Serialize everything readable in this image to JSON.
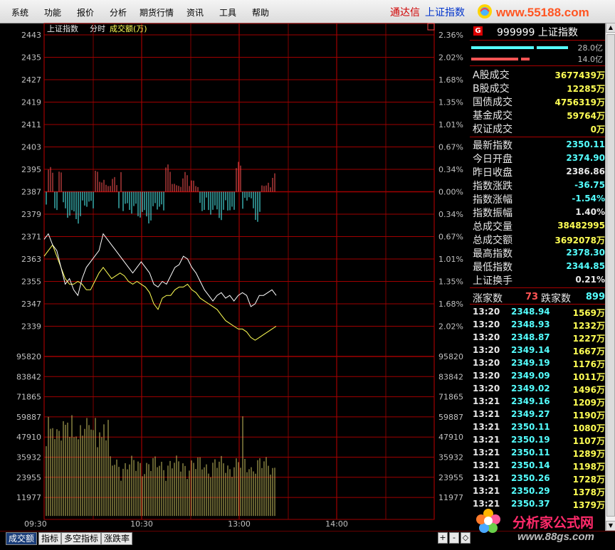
{
  "menu": [
    "系统",
    "功能",
    "报价",
    "分析",
    "期货行情",
    "资讯",
    "工具",
    "帮助"
  ],
  "app_name": "通达信",
  "current_index": "上证指数",
  "site_url": "www.55188.com",
  "chart": {
    "title": "上证指数",
    "mode": "分时",
    "volume_label": "成交额(万)",
    "price_ticks_left": [
      "2443",
      "2435",
      "2427",
      "2419",
      "2411",
      "2403",
      "2395",
      "2387",
      "2379",
      "2371",
      "2363",
      "2355",
      "2347",
      "2339"
    ],
    "price_ticks_right": [
      "2.36%",
      "2.02%",
      "1.68%",
      "1.35%",
      "1.01%",
      "0.67%",
      "0.34%",
      "0.00%",
      "0.34%",
      "0.67%",
      "1.01%",
      "1.35%",
      "1.68%",
      "2.02%"
    ],
    "volume_ticks": [
      "95820",
      "83842",
      "71865",
      "59887",
      "47910",
      "35932",
      "23955",
      "11977"
    ],
    "time_ticks": [
      "09:30",
      "10:30",
      "13:00",
      "14:00"
    ],
    "colors": {
      "grid": "#a00000",
      "up": "#ff5454",
      "down": "#54ffff",
      "price_line": "#ffffff",
      "avg_line": "#ffff54",
      "volume": "#c8c060"
    }
  },
  "chart_data": {
    "type": "line",
    "title": "上证指数",
    "x_axis": [
      "09:30",
      "10:30",
      "13:00",
      "14:00"
    ],
    "series": [
      {
        "name": "price",
        "values": [
          2370,
          2372,
          2368,
          2366,
          2360,
          2354,
          2356,
          2352,
          2350,
          2356,
          2360,
          2362,
          2364,
          2366,
          2372,
          2370,
          2368,
          2366,
          2364,
          2362,
          2360,
          2358,
          2360,
          2362,
          2360,
          2358,
          2354,
          2353,
          2355,
          2354,
          2357,
          2360,
          2361,
          2364,
          2363,
          2360,
          2358,
          2355,
          2352,
          2350,
          2348,
          2350,
          2351,
          2349,
          2350,
          2348,
          2350,
          2351,
          2350,
          2346,
          2347,
          2350,
          2350,
          2351,
          2352,
          2350
        ]
      },
      {
        "name": "average",
        "values": [
          2364,
          2366,
          2368,
          2364,
          2360,
          2356,
          2354,
          2354,
          2355,
          2354,
          2352,
          2352,
          2355,
          2358,
          2360,
          2358,
          2356,
          2357,
          2358,
          2357,
          2355,
          2354,
          2355,
          2354,
          2353,
          2351,
          2347,
          2345,
          2349,
          2350,
          2350,
          2352,
          2353,
          2353,
          2354,
          2352,
          2351,
          2349,
          2348,
          2347,
          2346,
          2345,
          2343,
          2341,
          2340,
          2339,
          2338,
          2338,
          2337,
          2335,
          2334,
          2335,
          2336,
          2337,
          2338,
          2339
        ]
      }
    ],
    "ylim": [
      2335,
      2443
    ]
  },
  "panel": {
    "code_name": "999999 上证指数",
    "bar1_value": "28.0亿",
    "bar2_value": "14.0亿",
    "stats1": [
      {
        "label": "A股成交",
        "value": "3677439万",
        "color": "#ffff54"
      },
      {
        "label": "B股成交",
        "value": "12285万",
        "color": "#ffff54"
      },
      {
        "label": "国债成交",
        "value": "4756319万",
        "color": "#ffff54"
      },
      {
        "label": "基金成交",
        "value": "59764万",
        "color": "#ffff54"
      },
      {
        "label": "权证成交",
        "value": "0万",
        "color": "#ffff54"
      }
    ],
    "stats2": [
      {
        "label": "最新指数",
        "value": "2350.11",
        "color": "#54ffff"
      },
      {
        "label": "今日开盘",
        "value": "2374.90",
        "color": "#54ffff"
      },
      {
        "label": "昨日收盘",
        "value": "2386.86",
        "color": "#e8e8e8"
      },
      {
        "label": "指数涨跌",
        "value": "-36.75",
        "color": "#54ffff"
      },
      {
        "label": "指数涨幅",
        "value": "-1.54%",
        "color": "#54ffff"
      },
      {
        "label": "指数振幅",
        "value": "1.40%",
        "color": "#e8e8e8"
      },
      {
        "label": "总成交量",
        "value": "38482995",
        "color": "#ffff54"
      },
      {
        "label": "总成交额",
        "value": "3692078万",
        "color": "#ffff54"
      },
      {
        "label": "最高指数",
        "value": "2378.30",
        "color": "#54ffff"
      },
      {
        "label": "最低指数",
        "value": "2344.85",
        "color": "#54ffff"
      },
      {
        "label": "上证换手",
        "value": "0.21%",
        "color": "#e8e8e8"
      }
    ],
    "up_label": "涨家数",
    "up_count": "73",
    "down_label": "跌家数",
    "down_count": "899",
    "trades": [
      {
        "time": "13:20",
        "price": "2348.94",
        "vol": "1569万"
      },
      {
        "time": "13:20",
        "price": "2348.93",
        "vol": "1232万"
      },
      {
        "time": "13:20",
        "price": "2348.87",
        "vol": "1227万"
      },
      {
        "time": "13:20",
        "price": "2349.14",
        "vol": "1667万"
      },
      {
        "time": "13:20",
        "price": "2349.19",
        "vol": "1176万"
      },
      {
        "time": "13:20",
        "price": "2349.09",
        "vol": "1011万"
      },
      {
        "time": "13:20",
        "price": "2349.02",
        "vol": "1496万"
      },
      {
        "time": "13:21",
        "price": "2349.16",
        "vol": "1209万"
      },
      {
        "time": "13:21",
        "price": "2349.27",
        "vol": "1190万"
      },
      {
        "time": "13:21",
        "price": "2350.11",
        "vol": "1080万"
      },
      {
        "time": "13:21",
        "price": "2350.19",
        "vol": "1107万"
      },
      {
        "time": "13:21",
        "price": "2350.11",
        "vol": "1289万"
      },
      {
        "time": "13:21",
        "price": "2350.14",
        "vol": "1198万"
      },
      {
        "time": "13:21",
        "price": "2350.26",
        "vol": "1728万"
      },
      {
        "time": "13:21",
        "price": "2350.29",
        "vol": "1378万"
      },
      {
        "time": "13:21",
        "price": "2350.37",
        "vol": "1379万"
      }
    ]
  },
  "bottom_tabs": [
    "成交额",
    "指标",
    "多空指标",
    "涨跌率"
  ],
  "nav_buttons": [
    "+",
    "-",
    "◇"
  ],
  "watermark": {
    "line1": "分析家公式网",
    "line2": "www.88gs.com"
  }
}
